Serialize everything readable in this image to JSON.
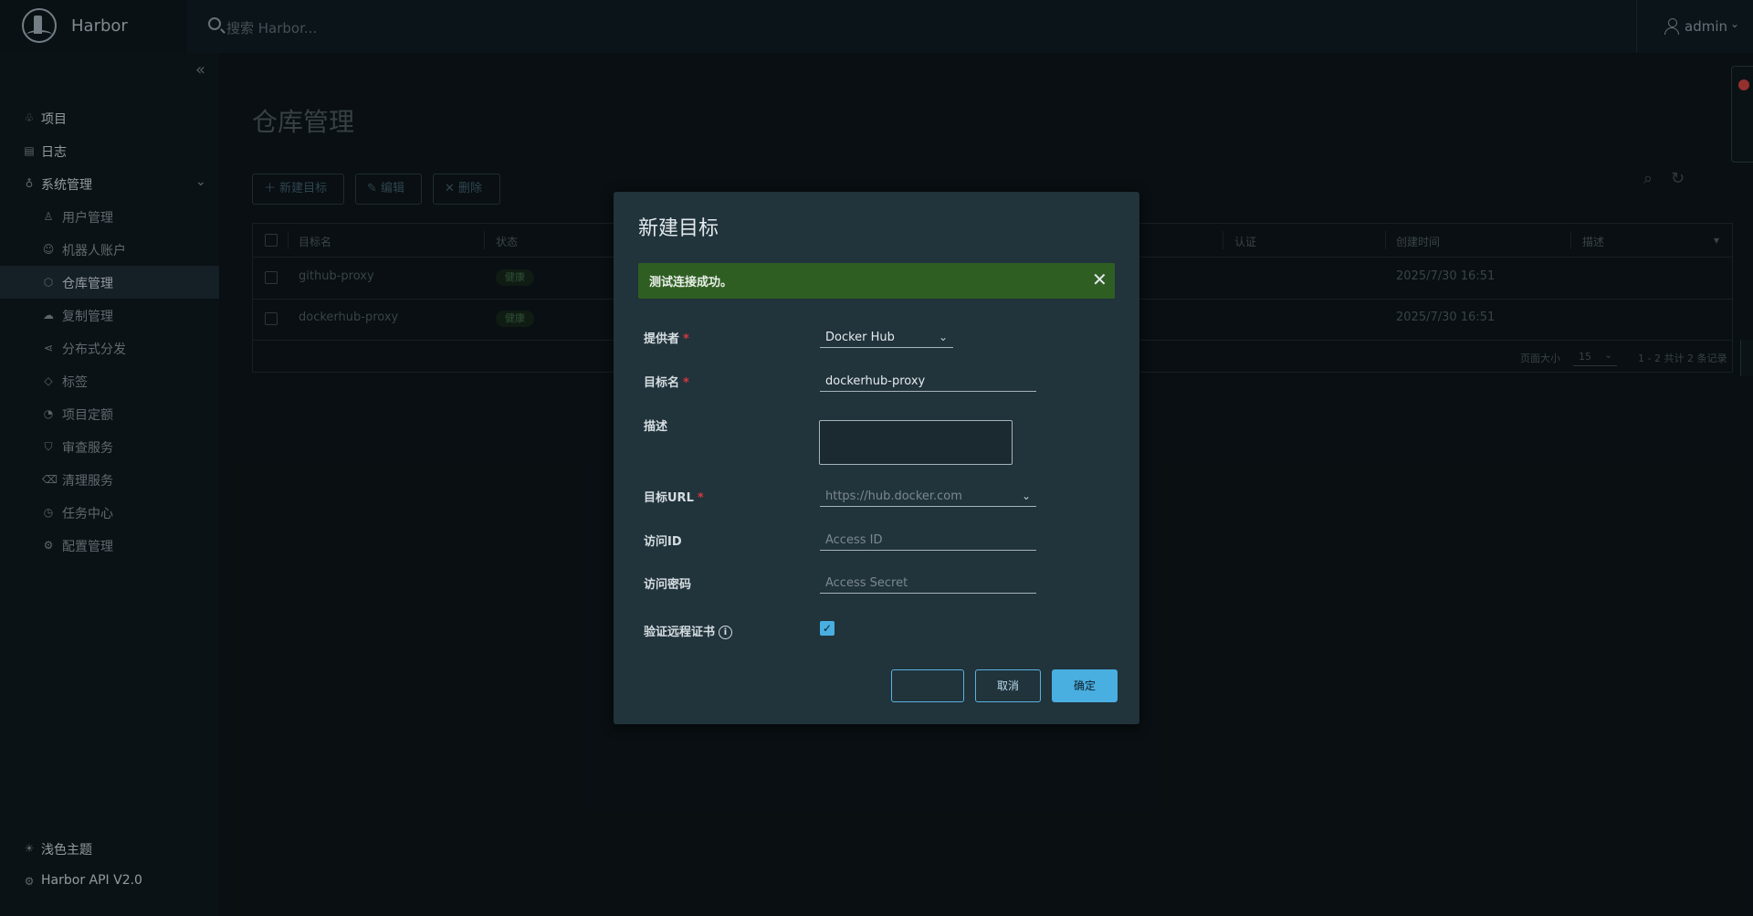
{
  "app": {
    "title": "Harbor"
  },
  "search": {
    "placeholder": "搜索 Harbor..."
  },
  "user": {
    "name": "admin"
  },
  "sidebar": {
    "items": [
      {
        "label": "项目"
      },
      {
        "label": "日志"
      },
      {
        "label": "系统管理"
      }
    ],
    "sub_items": [
      {
        "label": "用户管理"
      },
      {
        "label": "机器人账户"
      },
      {
        "label": "仓库管理"
      },
      {
        "label": "复制管理"
      },
      {
        "label": "分布式分发"
      },
      {
        "label": "标签"
      },
      {
        "label": "项目定额"
      },
      {
        "label": "审查服务"
      },
      {
        "label": "清理服务"
      },
      {
        "label": "任务中心"
      },
      {
        "label": "配置管理"
      }
    ],
    "bottom": [
      {
        "label": "浅色主题"
      },
      {
        "label": "Harbor API V2.0"
      }
    ]
  },
  "page": {
    "title": "仓库管理",
    "toolbar": {
      "new": "新建目标",
      "edit": "编辑",
      "delete": "删除"
    }
  },
  "table": {
    "columns": [
      "目标名",
      "状态",
      "认证",
      "创建时间",
      "描述"
    ],
    "rows": [
      {
        "name": "github-proxy",
        "status": "健康",
        "created": "2025/7/30 16:51"
      },
      {
        "name": "dockerhub-proxy",
        "status": "健康",
        "created": "2025/7/30 16:51"
      }
    ],
    "footer": {
      "page_size_label": "页面大小",
      "page_size": "15",
      "summary": "1 - 2 共计 2 条记录"
    }
  },
  "modal": {
    "title": "新建目标",
    "alert": "测试连接成功。",
    "fields": {
      "provider": {
        "label": "提供者",
        "value": "Docker Hub"
      },
      "name": {
        "label": "目标名",
        "value": "dockerhub-proxy"
      },
      "description": {
        "label": "描述"
      },
      "url": {
        "label": "目标URL",
        "placeholder": "https://hub.docker.com"
      },
      "access_id": {
        "label": "访问ID",
        "placeholder": "Access ID"
      },
      "access_secret": {
        "label": "访问密码",
        "placeholder": "Access Secret"
      },
      "verify_cert": {
        "label": "验证远程证书",
        "checked": true
      }
    },
    "buttons": {
      "test": "",
      "cancel": "取消",
      "ok": "确定"
    }
  }
}
